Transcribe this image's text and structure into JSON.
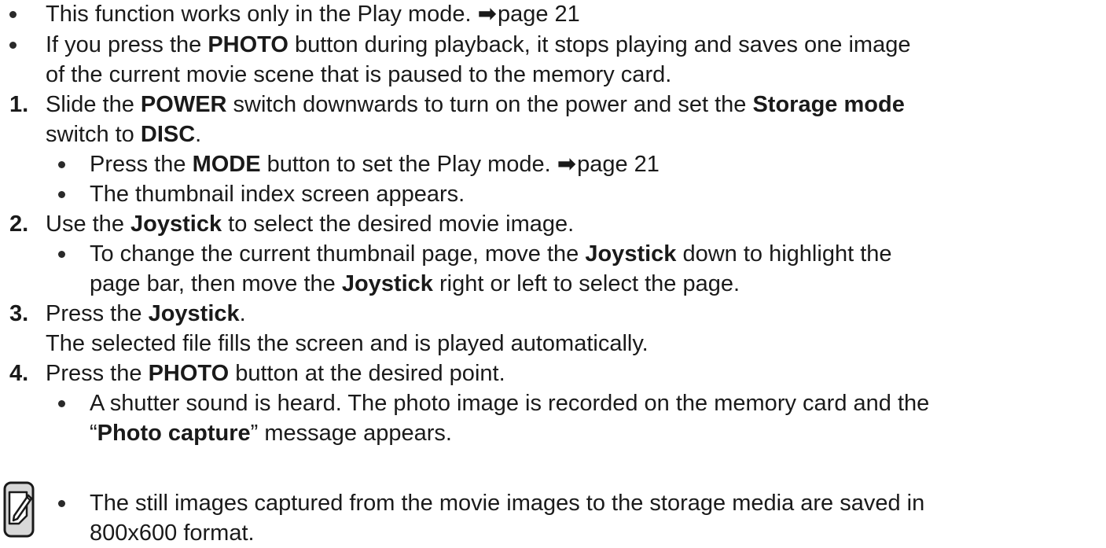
{
  "intro": {
    "b1": {
      "pre": "This function works only in the Play mode. ",
      "arrow": "➡",
      "ref": "page 21"
    },
    "b2": {
      "pre": "If you press the ",
      "bold": "PHOTO",
      "post": " button during playback, it stops playing and saves one image",
      "line2": "of the current movie scene that is paused to the memory card."
    }
  },
  "steps": [
    {
      "num": "1.",
      "l1_pre": "Slide the ",
      "l1_bold1": "POWER",
      "l1_mid": " switch downwards to turn on the power and set the ",
      "l1_bold2": "Storage mode",
      "l2_pre": "switch to ",
      "l2_bold": "DISC",
      "l2_post": ".",
      "sub1_pre": "Press the ",
      "sub1_bold": "MODE",
      "sub1_post": " button to set the Play mode. ",
      "sub1_arrow": "➡",
      "sub1_ref": "page 21",
      "sub2": "The thumbnail index screen appears."
    },
    {
      "num": "2.",
      "l1_pre": "Use the ",
      "l1_bold": "Joystick",
      "l1_post": " to select the desired movie image.",
      "sub1_pre": "To change the current thumbnail page, move the ",
      "sub1_bold1": "Joystick",
      "sub1_mid": " down to highlight the",
      "sub1_l2_pre": "page bar, then move the ",
      "sub1_bold2": "Joystick",
      "sub1_l2_post": " right or left to select the page."
    },
    {
      "num": "3.",
      "l1_pre": "Press the ",
      "l1_bold": "Joystick",
      "l1_post": ".",
      "l2": "The selected file fills the screen and is played automatically."
    },
    {
      "num": "4.",
      "l1_pre": "Press the ",
      "l1_bold": "PHOTO",
      "l1_post": " button at the desired point.",
      "sub1_l1": "A shutter sound is heard. The photo image is recorded on the memory card and the",
      "sub1_l2_pre": "“",
      "sub1_l2_bold": "Photo capture",
      "sub1_l2_post": "” message appears."
    }
  ],
  "note": {
    "icon": "note-pencil-icon",
    "line1": "The still images captured from the movie images to the storage media are saved in",
    "line2": "800x600 format."
  }
}
